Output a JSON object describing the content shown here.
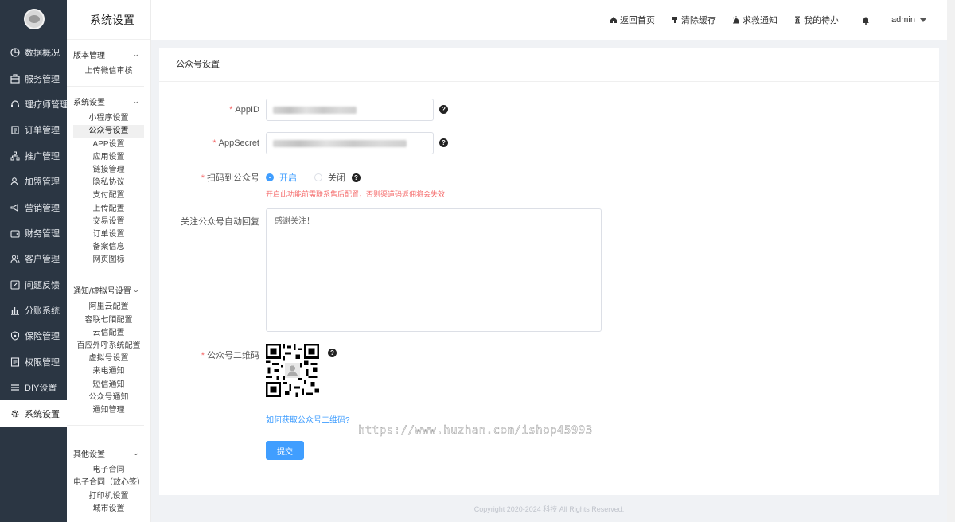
{
  "sidebar": {
    "items": [
      {
        "label": "数据概况",
        "icon": "pie-chart-icon"
      },
      {
        "label": "服务管理",
        "icon": "services-icon"
      },
      {
        "label": "理疗师管理",
        "icon": "headset-icon"
      },
      {
        "label": "订单管理",
        "icon": "clipboard-icon"
      },
      {
        "label": "推广管理",
        "icon": "network-icon"
      },
      {
        "label": "加盟管理",
        "icon": "user-add-icon"
      },
      {
        "label": "营销管理",
        "icon": "marketing-icon"
      },
      {
        "label": "财务管理",
        "icon": "wallet-icon"
      },
      {
        "label": "客户管理",
        "icon": "users-icon"
      },
      {
        "label": "问题反馈",
        "icon": "feedback-icon"
      },
      {
        "label": "分账系统",
        "icon": "bar-chart-icon"
      },
      {
        "label": "保险管理",
        "icon": "shield-icon"
      },
      {
        "label": "权限管理",
        "icon": "permission-icon"
      },
      {
        "label": "DIY设置",
        "icon": "layers-icon"
      },
      {
        "label": "系统设置",
        "icon": "gear-icon"
      }
    ]
  },
  "submenu": {
    "title": "系统设置",
    "groups": [
      {
        "title": "版本管理",
        "items": [
          "上传微信审核"
        ]
      },
      {
        "title": "系统设置",
        "items": [
          "小程序设置",
          "公众号设置",
          "APP设置",
          "应用设置",
          "链接管理",
          "隐私协议",
          "支付配置",
          "上传配置",
          "交易设置",
          "订单设置",
          "备案信息",
          "网页图标"
        ]
      },
      {
        "title": "通知/虚拟号设置",
        "items": [
          "阿里云配置",
          "容联七陌配置",
          "云信配置",
          "百应外呼系统配置",
          "虚拟号设置",
          "来电通知",
          "短信通知",
          "公众号通知",
          "通知管理"
        ]
      },
      {
        "title": "其他设置",
        "items": [
          "电子合同",
          "电子合同（放心签）",
          "打印机设置",
          "城市设置"
        ]
      }
    ]
  },
  "header": {
    "home": "返回首页",
    "clear_cache": "清除缓存",
    "sos": "求救通知",
    "todo": "我的待办",
    "user": "admin"
  },
  "card": {
    "title": "公众号设置",
    "appid_label": "AppID",
    "appsecret_label": "AppSecret",
    "scan_label": "扫码到公众号",
    "radio_on": "开启",
    "radio_off": "关闭",
    "warning": "开启此功能前需联系售后配置，否则渠道码返佣将会失效",
    "reply_label": "关注公众号自动回复",
    "reply_value": "感谢关注！",
    "qr_label": "公众号二维码",
    "qr_link": "如何获取公众号二维码?",
    "submit": "提交"
  },
  "watermark": "https://www.huzhan.com/ishop45993",
  "footer": "Copyright 2020-2024 科技 All Rights Reserved.",
  "colors": {
    "primary": "#409eff",
    "sidebar": "#2b3643",
    "danger": "#f56c6c"
  }
}
